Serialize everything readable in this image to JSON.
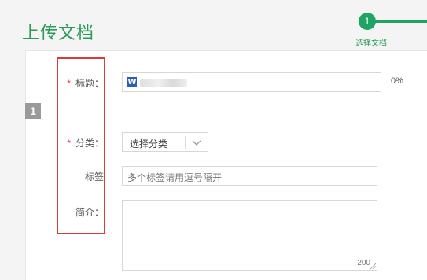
{
  "header": {
    "title": "上传文档"
  },
  "stepper": {
    "step_number": "1",
    "step_label": "选择文档",
    "accent": "#1fa463"
  },
  "section": {
    "number": "1"
  },
  "form": {
    "title_label": "标题：",
    "title_progress": "0%",
    "word_icon_letter": "W",
    "category_label": "分类：",
    "category_value": "选择分类",
    "tags_label": "标签",
    "tags_placeholder": "多个标签请用逗号隔开",
    "intro_label": "简介：",
    "intro_char_limit": "200",
    "required_mark": "*"
  },
  "colors": {
    "required": "#e23b3b",
    "highlight": "#d93a3a",
    "title": "#2a9a58"
  }
}
